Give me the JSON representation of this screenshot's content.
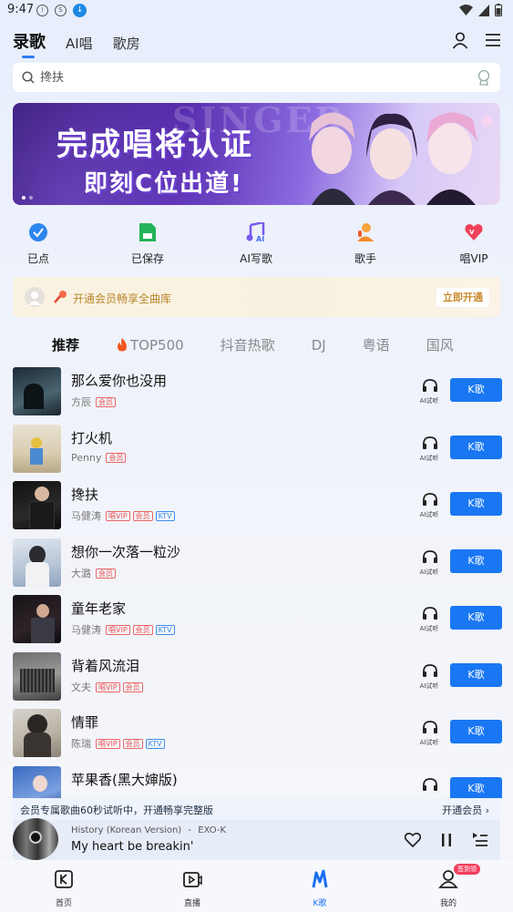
{
  "status_bar": {
    "time": "9:47"
  },
  "top_tabs": [
    {
      "label": "录歌",
      "active": true
    },
    {
      "label": "AI唱",
      "active": false
    },
    {
      "label": "歌房",
      "active": false
    }
  ],
  "search": {
    "placeholder": "搀扶"
  },
  "banner": {
    "line1": "完成唱将认证",
    "line2": "即刻C位出道!",
    "bg_text": "SINGER",
    "slide_count": 2,
    "active_slide": 1
  },
  "quick_entries": [
    {
      "label": "已点",
      "icon": "check-circle-icon"
    },
    {
      "label": "已保存",
      "icon": "saved-file-icon"
    },
    {
      "label": "AI写歌",
      "icon": "ai-music-note-icon"
    },
    {
      "label": "歌手",
      "icon": "singer-icon"
    },
    {
      "label": "唱VIP",
      "icon": "vip-heart-icon"
    }
  ],
  "vip_strip": {
    "text": "开通会员畅享全曲库",
    "button": "立即开通"
  },
  "category_tabs": [
    {
      "label": "推荐",
      "active": true
    },
    {
      "label": "TOP500",
      "active": false,
      "icon": "fire-icon"
    },
    {
      "label": "抖音热歌",
      "active": false
    },
    {
      "label": "DJ",
      "active": false
    },
    {
      "label": "粤语",
      "active": false
    },
    {
      "label": "国风",
      "active": false
    }
  ],
  "songs": [
    {
      "title": "那么爱你也没用",
      "artist": "方辰",
      "tags": [
        {
          "text": "会员"
        }
      ]
    },
    {
      "title": "打火机",
      "artist": "Penny",
      "tags": [
        {
          "text": "会员"
        }
      ]
    },
    {
      "title": "搀扶",
      "artist": "马健涛",
      "tags": [
        {
          "text": "唱VIP"
        },
        {
          "text": "会员"
        },
        {
          "text": "KTV",
          "blue": true
        }
      ]
    },
    {
      "title": "想你一次落一粒沙",
      "artist": "大潞",
      "tags": [
        {
          "text": "会员"
        }
      ]
    },
    {
      "title": "童年老家",
      "artist": "马健涛",
      "tags": [
        {
          "text": "唱VIP"
        },
        {
          "text": "会员"
        },
        {
          "text": "KTV",
          "blue": true
        }
      ]
    },
    {
      "title": "背着风流泪",
      "artist": "文夫",
      "tags": [
        {
          "text": "唱VIP"
        },
        {
          "text": "会员"
        }
      ]
    },
    {
      "title": "情罪",
      "artist": "陈瑞",
      "tags": [
        {
          "text": "唱VIP"
        },
        {
          "text": "会员"
        },
        {
          "text": "KTV",
          "blue": true
        }
      ]
    },
    {
      "title": "苹果香(黑大婶版)",
      "artist": "",
      "tags": []
    }
  ],
  "song_actions": {
    "listen_label": "AI试听",
    "k_label": "K歌"
  },
  "trial_bar": {
    "text": "会员专属歌曲60秒试听中，开通畅享完整版",
    "link": "开通会员"
  },
  "player": {
    "song": "History (Korean Version)",
    "artist": "EXO-K",
    "separator": "-",
    "lyric": "My heart be breakin'"
  },
  "bottom_nav": [
    {
      "label": "首页",
      "active": false,
      "icon": "home-k-icon"
    },
    {
      "label": "直播",
      "active": false,
      "icon": "live-tv-icon"
    },
    {
      "label": "K歌",
      "active": true,
      "icon": "k-song-icon"
    },
    {
      "label": "我的",
      "active": false,
      "icon": "profile-icon",
      "badge": "签到领"
    }
  ],
  "colors": {
    "accent": "#1977f3",
    "vip_gold": "#c8892a",
    "tag_red": "#e55555"
  }
}
